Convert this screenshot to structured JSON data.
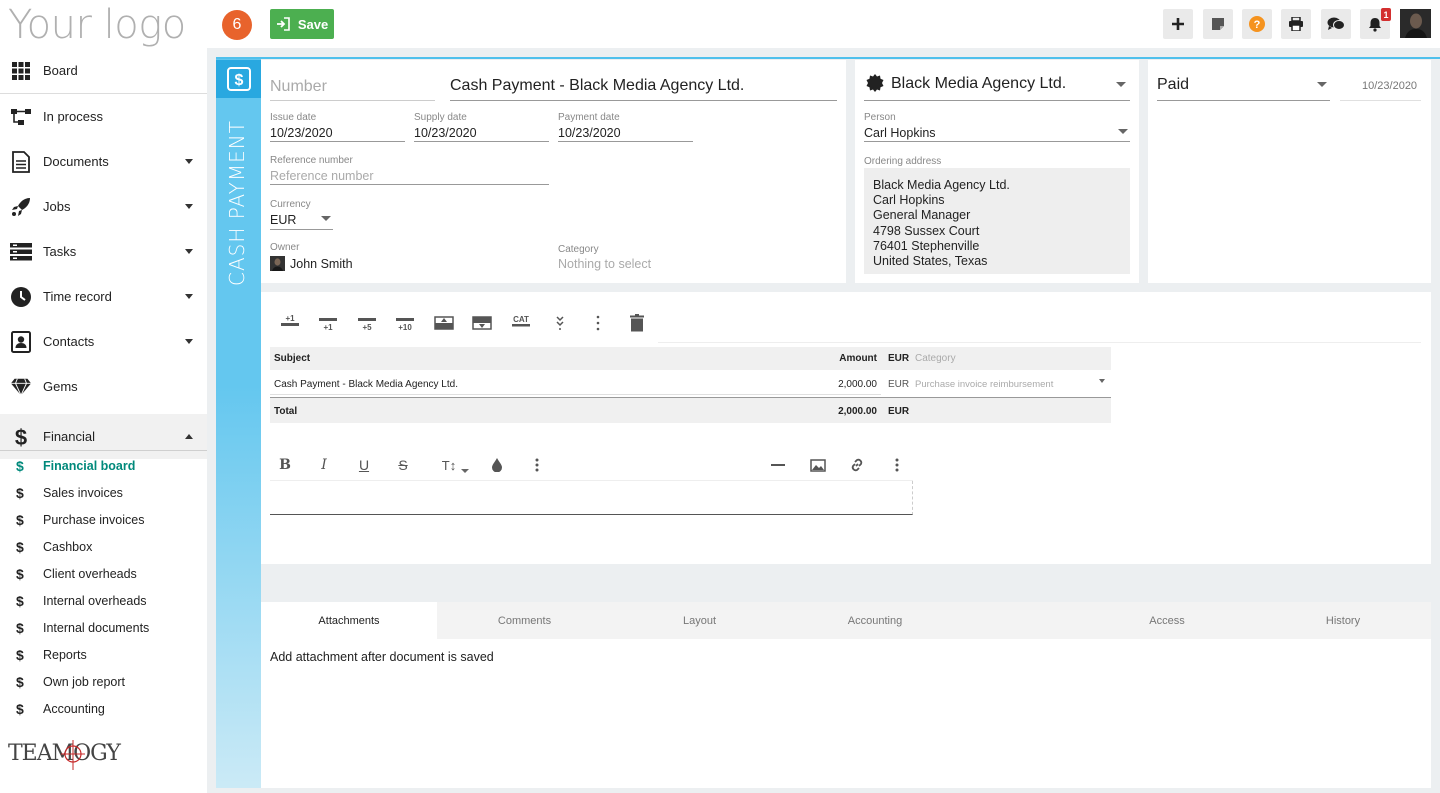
{
  "header": {
    "logo_text": "Your logo",
    "counter_badge": "6",
    "save_label": "Save",
    "notification_count": "1"
  },
  "sidebar": {
    "items": [
      {
        "label": "Board",
        "icon": "grid-icon"
      },
      {
        "label": "In process",
        "icon": "flow-icon"
      },
      {
        "label": "Documents",
        "icon": "document-icon"
      },
      {
        "label": "Jobs",
        "icon": "rocket-icon"
      },
      {
        "label": "Tasks",
        "icon": "tasks-icon"
      },
      {
        "label": "Time record",
        "icon": "clock-icon"
      },
      {
        "label": "Contacts",
        "icon": "contacts-icon"
      },
      {
        "label": "Gems",
        "icon": "gem-icon"
      },
      {
        "label": "Financial",
        "icon": "dollar-icon"
      }
    ],
    "financial_sub": [
      "Financial board",
      "Sales invoices",
      "Purchase invoices",
      "Cashbox",
      "Client overheads",
      "Internal overheads",
      "Internal documents",
      "Reports",
      "Own job report",
      "Accounting"
    ],
    "footer_brand": "TEAMOGY"
  },
  "doc": {
    "type_vertical": "CASH PAYMENT",
    "number_placeholder": "Number",
    "title": "Cash Payment - Black Media Agency Ltd.",
    "issue_date_label": "Issue date",
    "issue_date": "10/23/2020",
    "supply_date_label": "Supply date",
    "supply_date": "10/23/2020",
    "payment_date_label": "Payment date",
    "payment_date": "10/23/2020",
    "reference_label": "Reference number",
    "reference_placeholder": "Reference number",
    "currency_label": "Currency",
    "currency": "EUR",
    "owner_label": "Owner",
    "owner": "John Smith",
    "category_label": "Category",
    "category_placeholder": "Nothing to select"
  },
  "client": {
    "company": "Black Media Agency Ltd.",
    "person_label": "Person",
    "person": "Carl Hopkins",
    "address_label": "Ordering address",
    "address_lines": {
      "l1": "Black Media Agency Ltd.",
      "l2": "Carl Hopkins",
      "l3": "General Manager",
      "l4": "4798 Sussex Court",
      "l5": "76401 Stephenville",
      "l6": "United States, Texas"
    }
  },
  "status": {
    "value": "Paid",
    "date": "10/23/2020"
  },
  "toolbar": {
    "add1": "+1",
    "row1": "+1",
    "row5": "+5",
    "row10": "+10",
    "cat": "CAT"
  },
  "table": {
    "headers": {
      "subject": "Subject",
      "amount": "Amount",
      "currency": "EUR",
      "category": "Category"
    },
    "rows": [
      {
        "subject": "Cash Payment - Black Media Agency Ltd.",
        "amount": "2,000.00",
        "currency": "EUR",
        "category": "Purchase invoice reimbursement"
      }
    ],
    "total": {
      "label": "Total",
      "amount": "2,000.00",
      "currency": "EUR"
    }
  },
  "editor": {
    "bold": "B",
    "italic": "I",
    "underline": "U",
    "strike": "S",
    "textsize": "T↕"
  },
  "tabs": [
    {
      "label": "Attachments",
      "active": true
    },
    {
      "label": "Comments"
    },
    {
      "label": "Layout"
    },
    {
      "label": "Accounting"
    },
    {
      "label": "Access"
    },
    {
      "label": "History"
    }
  ],
  "attachments_message": "Add attachment after document is saved"
}
